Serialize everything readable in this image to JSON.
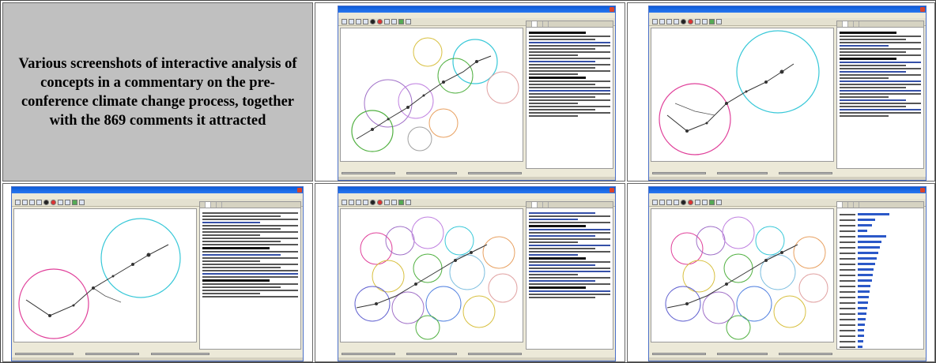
{
  "caption": "Various screenshots of interactive analysis of concepts in a commentary on the pre-conference climate change process, together with the 869 comments it attracted",
  "colors": {
    "caption_bg": "#c0c0c0",
    "titlebar": "#0a5ad8",
    "window_bg": "#ece9d8",
    "cluster_magenta": "#e0409a",
    "cluster_cyan": "#38c8d8",
    "cluster_green": "#50b040",
    "cluster_purple": "#a070c8",
    "cluster_orange": "#e8a060",
    "cluster_yellow": "#d8c040",
    "relevance_bar": "#2b58c8"
  },
  "icons": [
    "close-icon",
    "zoom-icon",
    "node-icon",
    "delete-icon",
    "search-icon",
    "pin-icon",
    "settings-icon"
  ]
}
